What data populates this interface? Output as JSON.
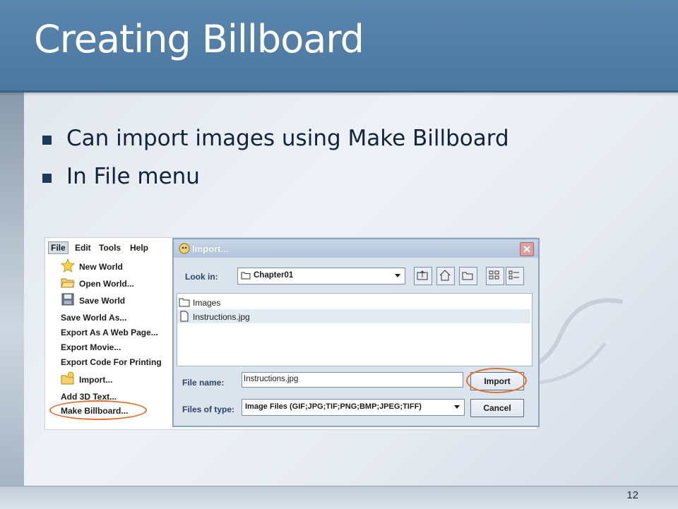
{
  "slide": {
    "title": "Creating Billboard",
    "bullets": [
      "Can import images using Make Billboard",
      "In File menu"
    ],
    "page_number": "12"
  },
  "menu_bar": {
    "items": [
      "File",
      "Edit",
      "Tools",
      "Help"
    ]
  },
  "file_menu": {
    "items": [
      {
        "label": "New World",
        "icon": "star-icon"
      },
      {
        "label": "Open World...",
        "icon": "open-folder-icon"
      },
      {
        "label": "Save World",
        "icon": "floppy-disk-icon"
      },
      {
        "label": "Save World As...",
        "icon": ""
      },
      {
        "label": "Export As A Web Page...",
        "icon": ""
      },
      {
        "label": "Export Movie...",
        "icon": ""
      },
      {
        "label": "Export Code For Printing",
        "icon": ""
      },
      {
        "label": "Import...",
        "icon": "import-folder-icon"
      },
      {
        "label": "Add 3D Text...",
        "icon": ""
      },
      {
        "label": "Make Billboard...",
        "icon": ""
      }
    ],
    "highlighted": "Make Billboard..."
  },
  "dialog": {
    "title": "Import...",
    "look_in_label": "Look in:",
    "look_in_value": "Chapter01",
    "files": [
      {
        "name": "Images",
        "type": "folder"
      },
      {
        "name": "Instructions.jpg",
        "type": "file",
        "selected": true
      }
    ],
    "file_name_label": "File name:",
    "file_name_value": "Instructions.jpg",
    "files_of_type_label": "Files of type:",
    "files_of_type_value": "Image Files (GIF;JPG;TIF;PNG;BMP;JPEG;TIFF)",
    "import_button": "Import",
    "cancel_button": "Cancel"
  },
  "colors": {
    "title_bar": "#4b77a0",
    "bullet_mark": "#1c3a5e",
    "highlight_circle": "#e0702c"
  }
}
